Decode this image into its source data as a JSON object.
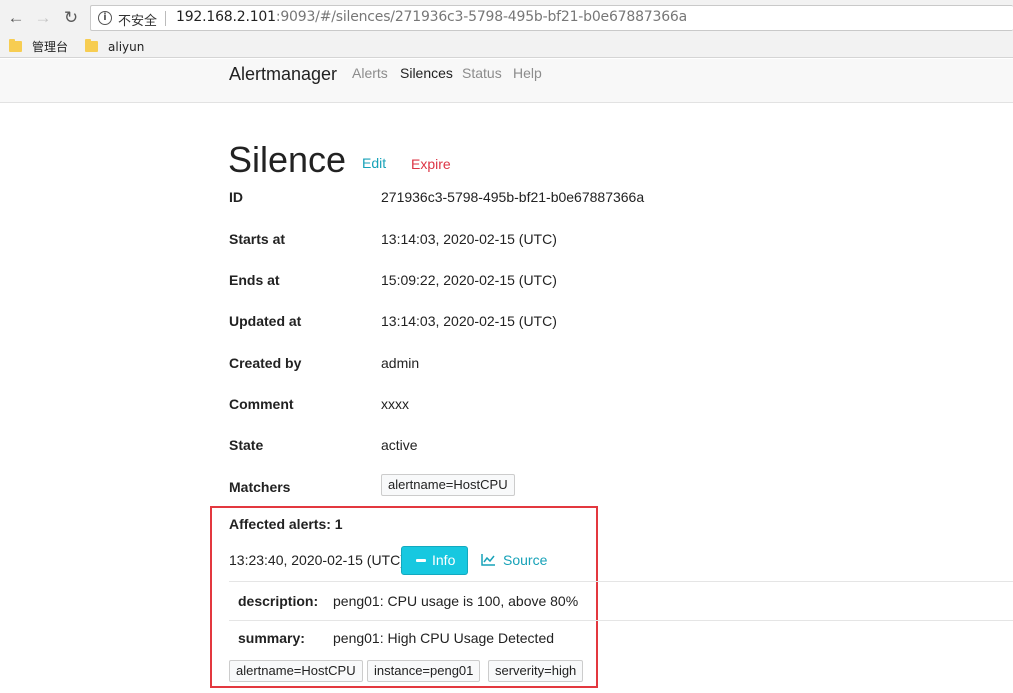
{
  "browser": {
    "insecure_label": "不安全",
    "url_host": "192.168.2.101",
    "url_rest": ":9093/#/silences/271936c3-5798-495b-bf21-b0e67887366a",
    "bookmarks": [
      {
        "label": "管理台"
      },
      {
        "label": "aliyun"
      }
    ]
  },
  "navbar": {
    "brand": "Alertmanager",
    "links": [
      "Alerts",
      "Silences",
      "Status",
      "Help"
    ],
    "active": "Silences"
  },
  "page": {
    "title": "Silence",
    "edit_label": "Edit",
    "expire_label": "Expire"
  },
  "details": [
    {
      "label": "ID",
      "value": "271936c3-5798-495b-bf21-b0e67887366a"
    },
    {
      "label": "Starts at",
      "value": "13:14:03, 2020-02-15 (UTC)"
    },
    {
      "label": "Ends at",
      "value": "15:09:22, 2020-02-15 (UTC)"
    },
    {
      "label": "Updated at",
      "value": "13:14:03, 2020-02-15 (UTC)"
    },
    {
      "label": "Created by",
      "value": "admin"
    },
    {
      "label": "Comment",
      "value": "xxxx"
    },
    {
      "label": "State",
      "value": "active"
    }
  ],
  "matchers": {
    "label": "Matchers",
    "items": [
      "alertname=HostCPU"
    ]
  },
  "affected": {
    "heading": "Affected alerts: 1",
    "alert_time": "13:23:40, 2020-02-15 (UTC)",
    "info_label": "Info",
    "source_label": "Source",
    "annotations": [
      {
        "key": "description:",
        "value": "peng01: CPU usage is 100, above 80%"
      },
      {
        "key": "summary:",
        "value": "peng01: High CPU Usage Detected"
      }
    ],
    "labels": [
      "alertname=HostCPU",
      "instance=peng01",
      "serverity=high"
    ]
  },
  "colors": {
    "accent": "#17a2b8",
    "info_button": "#17c8e0",
    "danger": "#dc3545",
    "highlight_box": "#e3383f"
  }
}
